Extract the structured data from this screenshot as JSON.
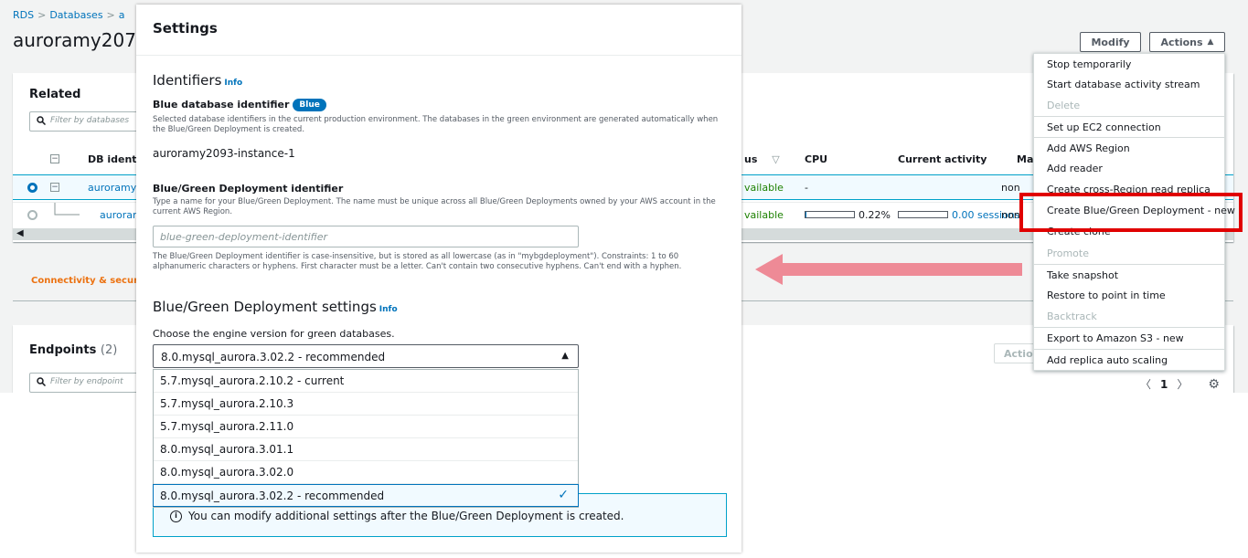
{
  "breadcrumb": {
    "root": "RDS",
    "databases": "Databases",
    "current": "a"
  },
  "page_title": "auroramy207",
  "header_buttons": {
    "modify": "Modify",
    "actions": "Actions"
  },
  "related": {
    "title": "Related",
    "filter_placeholder": "Filter by databases",
    "columns": {
      "db_identifier": "DB identi",
      "status": "us",
      "cpu": "CPU",
      "current_activity": "Current activity",
      "maintenance": "Mai"
    },
    "rows": [
      {
        "identifier": "auroramy",
        "status": "vailable",
        "cpu": "-",
        "activity": "",
        "maint": "non"
      },
      {
        "identifier": "auroran",
        "status": "vailable",
        "cpu": "0.22%",
        "cpu_fraction": 0.22,
        "activity": "0.00 sessions",
        "activity_fraction": 0.0,
        "maint": "non"
      }
    ]
  },
  "connectivity_tab": "Connectivity & security",
  "endpoints": {
    "title": "Endpoints",
    "count": "(2)",
    "filter_placeholder": "Filter by endpoint",
    "actions_label": "Actions",
    "page": "1"
  },
  "actions_menu": {
    "items": [
      {
        "label": "Stop temporarily",
        "disabled": false
      },
      {
        "label": "Start database activity stream",
        "disabled": false
      },
      {
        "label": "Delete",
        "disabled": true
      },
      {
        "label": "Set up EC2 connection",
        "disabled": false
      },
      {
        "label": "Add AWS Region",
        "disabled": false
      },
      {
        "label": "Add reader",
        "disabled": false
      },
      {
        "label": "Create cross-Region read replica",
        "disabled": false
      },
      {
        "label": "Create Blue/Green Deployment - new",
        "disabled": false
      },
      {
        "label": "Create clone",
        "disabled": false
      },
      {
        "label": "Promote",
        "disabled": true
      },
      {
        "label": "Take snapshot",
        "disabled": false
      },
      {
        "label": "Restore to point in time",
        "disabled": false
      },
      {
        "label": "Backtrack",
        "disabled": true
      },
      {
        "label": "Export to Amazon S3 - new",
        "disabled": false
      },
      {
        "label": "Add replica auto scaling",
        "disabled": false
      }
    ]
  },
  "modal": {
    "title": "Settings",
    "identifiers": {
      "title": "Identifiers",
      "info": "Info",
      "blue_label": "Blue database identifier",
      "blue_badge": "Blue",
      "blue_desc": "Selected database identifiers in the current production environment. The databases in the green environment are generated automatically when the Blue/Green Deployment is created.",
      "blue_value": "auroramy2093-instance-1",
      "bg_label": "Blue/Green Deployment identifier",
      "bg_desc": "Type a name for your Blue/Green Deployment. The name must be unique across all Blue/Green Deployments owned by your AWS account in the current AWS Region.",
      "bg_placeholder": "blue-green-deployment-identifier",
      "bg_constraints": "The Blue/Green Deployment identifier is case-insensitive, but is stored as all lowercase (as in \"mybgdeployment\"). Constraints: 1 to 60 alphanumeric characters or hyphens. First character must be a letter. Can't contain two consecutive hyphens. Can't end with a hyphen."
    },
    "bg_settings": {
      "title": "Blue/Green Deployment settings",
      "info": "Info",
      "prompt": "Choose the engine version for green databases.",
      "selected": "8.0.mysql_aurora.3.02.2 - recommended",
      "options": [
        "5.7.mysql_aurora.2.10.2 - current",
        "5.7.mysql_aurora.2.10.3",
        "5.7.mysql_aurora.2.11.0",
        "8.0.mysql_aurora.3.01.1",
        "8.0.mysql_aurora.3.02.0",
        "8.0.mysql_aurora.3.02.2 - recommended"
      ],
      "selected_index": 5
    },
    "alert": "You can modify additional settings after the Blue/Green Deployment is created."
  },
  "colors": {
    "accent": "#0073bb",
    "highlight": "#e00000",
    "pink_arrow": "#ee8a96",
    "available": "#1d8102",
    "tab": "#ec7211"
  }
}
